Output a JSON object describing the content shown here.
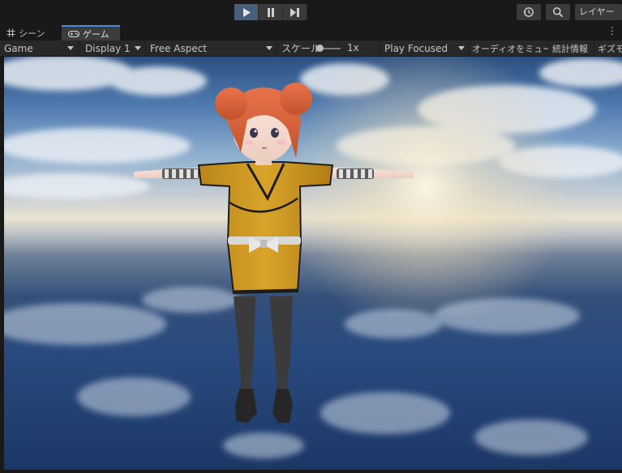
{
  "toolbar": {
    "play_icon": "play-icon",
    "pause_icon": "pause-icon",
    "step_icon": "step-icon",
    "history_icon": "history-icon",
    "search_icon": "search-icon",
    "layers_label": "レイヤー"
  },
  "tabs": [
    {
      "label": "シーン",
      "icon": "grid-hash-icon"
    },
    {
      "label": "ゲーム",
      "icon": "gamepad-icon",
      "active": true
    }
  ],
  "game_toolbar": {
    "mode": "Game",
    "display": "Display 1",
    "aspect": "Free Aspect",
    "scale_label": "スケール",
    "scale_value": "1x",
    "play_mode": "Play Focused",
    "mute_audio": "オーディオをミュート",
    "stats": "統計情報",
    "gizmos": "ギズモ"
  },
  "colors": {
    "accent": "#4a8be0",
    "play_active": "#46607c",
    "panel": "#282828"
  }
}
